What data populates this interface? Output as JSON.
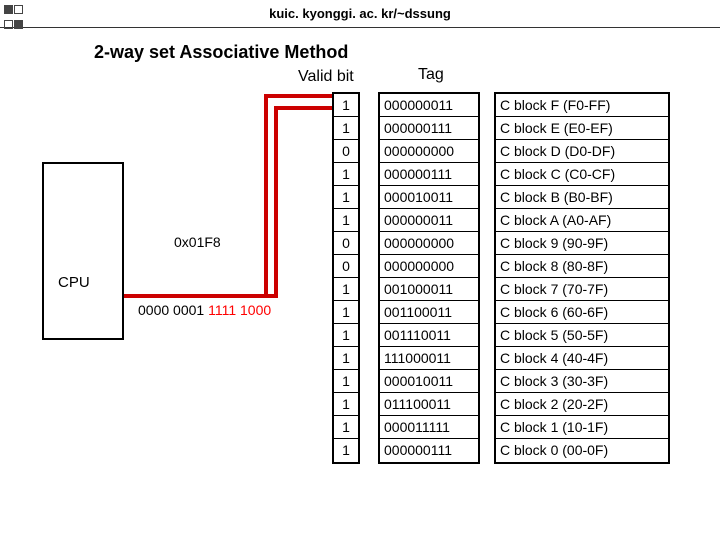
{
  "header": "kuic. kyonggi. ac. kr/~dssung",
  "title": "2-way set Associative Method",
  "labels": {
    "validbit": "Valid bit",
    "tag": "Tag",
    "cpu": "CPU",
    "hex": "0x01F8",
    "bin_prefix": "0000 0001 ",
    "bin_red": "1111 1000"
  },
  "chart_data": {
    "type": "table",
    "columns": [
      "valid",
      "tag",
      "block"
    ],
    "rows": [
      {
        "valid": "1",
        "tag": "000000011",
        "block": "C block F (F0-FF)"
      },
      {
        "valid": "1",
        "tag": "000000111",
        "block": "C block E (E0-EF)"
      },
      {
        "valid": "0",
        "tag": "000000000",
        "block": "C block D (D0-DF)"
      },
      {
        "valid": "1",
        "tag": "000000111",
        "block": "C block C (C0-CF)"
      },
      {
        "valid": "1",
        "tag": "000010011",
        "block": "C block B (B0-BF)"
      },
      {
        "valid": "1",
        "tag": "000000011",
        "block": "C block A (A0-AF)"
      },
      {
        "valid": "0",
        "tag": "000000000",
        "block": "C block 9 (90-9F)"
      },
      {
        "valid": "0",
        "tag": "000000000",
        "block": "C block 8 (80-8F)"
      },
      {
        "valid": "1",
        "tag": "001000011",
        "block": "C block 7 (70-7F)"
      },
      {
        "valid": "1",
        "tag": "001100011",
        "block": "C block 6 (60-6F)"
      },
      {
        "valid": "1",
        "tag": "001110011",
        "block": "C block 5 (50-5F)"
      },
      {
        "valid": "1",
        "tag": "111000011",
        "block": "C block 4 (40-4F)"
      },
      {
        "valid": "1",
        "tag": "000010011",
        "block": "C block 3 (30-3F)"
      },
      {
        "valid": "1",
        "tag": "011100011",
        "block": "C block 2 (20-2F)"
      },
      {
        "valid": "1",
        "tag": "000011111",
        "block": "C block 1 (10-1F)"
      },
      {
        "valid": "1",
        "tag": "000000111",
        "block": "C block 0 (00-0F)"
      }
    ]
  }
}
